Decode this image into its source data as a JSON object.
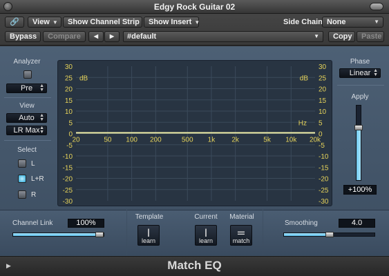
{
  "window": {
    "title": "Edgy Rock Guitar 02"
  },
  "toolbar": {
    "view": "View",
    "show_channel_strip": "Show Channel Strip",
    "show_insert": "Show Insert",
    "side_chain_label": "Side Chain:",
    "side_chain_value": "None",
    "bypass": "Bypass",
    "compare": "Compare",
    "preset": "#default",
    "copy": "Copy",
    "paste": "Paste"
  },
  "left": {
    "analyzer_label": "Analyzer",
    "analyzer_mode": "Pre",
    "view_label": "View",
    "view_mode": "Auto",
    "view_range": "LR Max",
    "select_label": "Select",
    "channels": [
      {
        "label": "L",
        "selected": false
      },
      {
        "label": "L+R",
        "selected": true
      },
      {
        "label": "R",
        "selected": false
      }
    ]
  },
  "graph": {
    "unit_db": "dB",
    "unit_hz": "Hz",
    "y_labels": [
      "30",
      "25",
      "20",
      "15",
      "10",
      "5",
      "0",
      "-5",
      "-10",
      "-15",
      "-20",
      "-25",
      "-30"
    ],
    "x_labels": [
      "20",
      "50",
      "100",
      "200",
      "500",
      "1k",
      "2k",
      "5k",
      "10k",
      "20k"
    ],
    "curve_color": "#f2f0a8"
  },
  "right": {
    "phase_label": "Phase",
    "phase_mode": "Linear",
    "apply_label": "Apply",
    "apply_value": "+100%",
    "apply_level": 0.7
  },
  "bottom": {
    "channel_link_label": "Channel Link",
    "channel_link_value": "100%",
    "channel_link_level": 1.0,
    "template_label": "Template",
    "current_label": "Current",
    "material_label": "Material",
    "learn": "learn",
    "match": "match",
    "smoothing_label": "Smoothing",
    "smoothing_value": "4.0",
    "smoothing_level": 0.5
  },
  "footer": {
    "plugin_name": "Match EQ"
  },
  "colors": {
    "accent": "#6fc9f0",
    "graph_text": "#e6d35a",
    "panel": "#4d6075"
  }
}
